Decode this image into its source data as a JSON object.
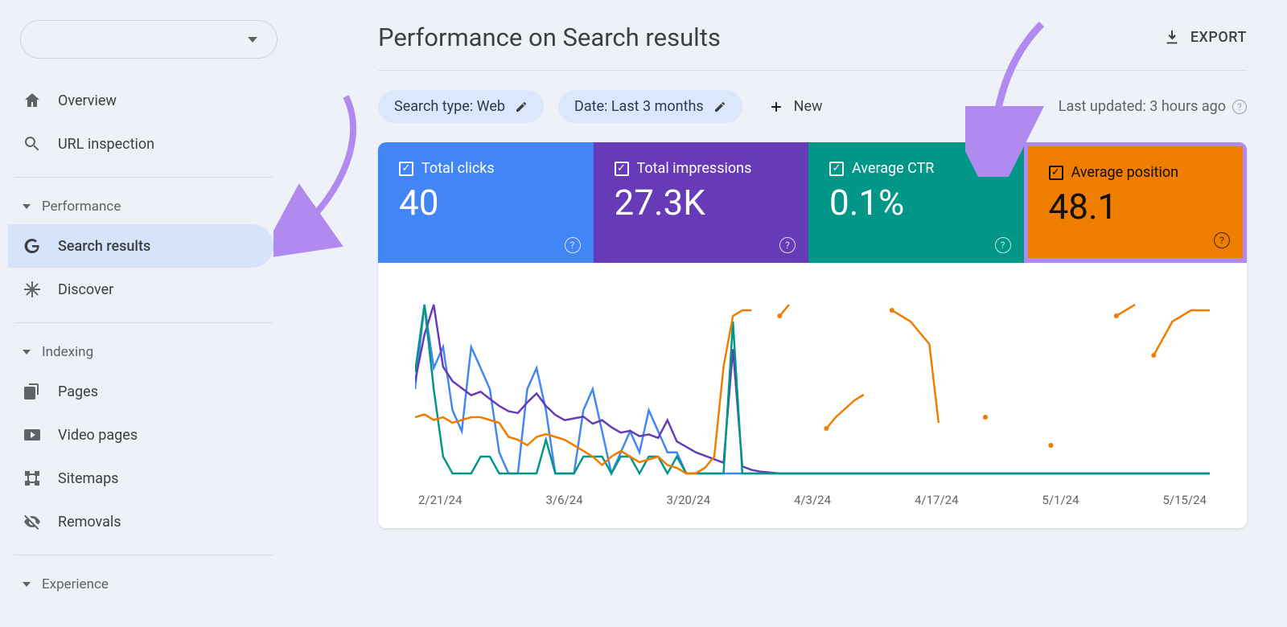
{
  "sidebar": {
    "group_overview": {
      "overview": "Overview",
      "url_inspection": "URL inspection"
    },
    "performance": {
      "heading": "Performance",
      "search_results": "Search results",
      "discover": "Discover"
    },
    "indexing": {
      "heading": "Indexing",
      "pages": "Pages",
      "video_pages": "Video pages",
      "sitemaps": "Sitemaps",
      "removals": "Removals"
    },
    "experience": {
      "heading": "Experience"
    }
  },
  "header": {
    "title": "Performance on Search results",
    "export": "EXPORT"
  },
  "filters": {
    "search_type": "Search type: Web",
    "date": "Date: Last 3 months",
    "new": "New",
    "updated": "Last updated: 3 hours ago"
  },
  "metrics": {
    "clicks": {
      "label": "Total clicks",
      "value": "40"
    },
    "impressions": {
      "label": "Total impressions",
      "value": "27.3K"
    },
    "ctr": {
      "label": "Average CTR",
      "value": "0.1%"
    },
    "position": {
      "label": "Average position",
      "value": "48.1"
    }
  },
  "chart_data": {
    "type": "line",
    "x_ticks": [
      "2/21/24",
      "3/6/24",
      "3/20/24",
      "4/3/24",
      "4/17/24",
      "5/1/24",
      "5/15/24"
    ],
    "xlabel": "",
    "ylabel": "",
    "note": "Approximate daily values read from the chart. Four series map to the four metric tiles. Scales differ per series; normalized values shown.",
    "series": [
      {
        "name": "Total clicks",
        "color": "#4285f4",
        "values": [
          4,
          8,
          5,
          6,
          3,
          2,
          6,
          5,
          4,
          1,
          0,
          0,
          4,
          5,
          3,
          0,
          0,
          0,
          3,
          4,
          2,
          0,
          1,
          2,
          1,
          3,
          2,
          1,
          1,
          0,
          0,
          0,
          0,
          0,
          0,
          0,
          0,
          0,
          0,
          0,
          0,
          0,
          0,
          0,
          0,
          0,
          0,
          0,
          0,
          0,
          0,
          0,
          0,
          0,
          0,
          0,
          0,
          0,
          0,
          0,
          0,
          0,
          0,
          0,
          0,
          0,
          0,
          0,
          0,
          0,
          0,
          0,
          0,
          0,
          0,
          0,
          0,
          0,
          0,
          0,
          0,
          0,
          0,
          0,
          0,
          0
        ]
      },
      {
        "name": "Total impressions",
        "color": "#673ab7",
        "values": [
          520,
          780,
          950,
          600,
          520,
          480,
          440,
          460,
          420,
          380,
          350,
          340,
          400,
          450,
          380,
          330,
          300,
          310,
          320,
          280,
          300,
          260,
          230,
          240,
          210,
          220,
          200,
          300,
          180,
          150,
          120,
          100,
          80,
          60,
          700,
          40,
          20,
          10,
          5,
          0,
          0,
          0,
          0,
          0,
          0,
          0,
          0,
          0,
          0,
          0,
          0,
          0,
          0,
          0,
          0,
          0,
          0,
          0,
          0,
          0,
          0,
          0,
          0,
          0,
          0,
          0,
          0,
          0,
          0,
          0,
          0,
          0,
          0,
          0,
          0,
          0,
          0,
          0,
          0,
          0,
          0,
          0,
          0,
          0,
          0,
          0
        ]
      },
      {
        "name": "Average CTR",
        "color": "#009688",
        "values": [
          0.6,
          1.0,
          0.5,
          0.1,
          0.0,
          0.0,
          0.0,
          0.1,
          0.1,
          0.0,
          0.0,
          0.0,
          0.0,
          0.0,
          0.2,
          0.0,
          0.0,
          0.0,
          0.1,
          0.1,
          0.1,
          0.0,
          0.1,
          0.1,
          0.0,
          0.1,
          0.1,
          0.0,
          0.1,
          0.0,
          0.0,
          0.0,
          0.0,
          0.0,
          0.9,
          0.0,
          0.0,
          0.0,
          0.0,
          0.0,
          0.0,
          0.0,
          0.0,
          0.0,
          0.0,
          0.0,
          0.0,
          0.0,
          0.0,
          0.0,
          0.0,
          0.0,
          0.0,
          0.0,
          0.0,
          0.0,
          0.0,
          0.0,
          0.0,
          0.0,
          0.0,
          0.0,
          0.0,
          0.0,
          0.0,
          0.0,
          0.0,
          0.0,
          0.0,
          0.0,
          0.0,
          0.0,
          0.0,
          0.0,
          0.0,
          0.0,
          0.0,
          0.0,
          0.0,
          0.0,
          0.0,
          0.0,
          0.0,
          0.0,
          0.0,
          0.0
        ]
      },
      {
        "name": "Average position",
        "color": "#ef7d00",
        "values": [
          48,
          47,
          49,
          48,
          50,
          49,
          48,
          48,
          49,
          50,
          55,
          56,
          58,
          55,
          54,
          55,
          56,
          58,
          60,
          62,
          65,
          62,
          60,
          62,
          64,
          63,
          62,
          65,
          66,
          68,
          68,
          66,
          62,
          30,
          12,
          10,
          10,
          null,
          null,
          12,
          8,
          null,
          null,
          null,
          52,
          48,
          45,
          42,
          40,
          null,
          null,
          10,
          12,
          14,
          18,
          22,
          50,
          null,
          null,
          null,
          null,
          48,
          null,
          null,
          null,
          null,
          null,
          null,
          58,
          null,
          null,
          null,
          null,
          null,
          null,
          12,
          10,
          8,
          null,
          26,
          20,
          14,
          12,
          10,
          10,
          10
        ]
      }
    ]
  },
  "colors": {
    "clicks": "#4285f4",
    "impressions": "#673ab7",
    "ctr": "#009688",
    "position": "#ef7d00",
    "highlight_border": "#b18af0"
  }
}
